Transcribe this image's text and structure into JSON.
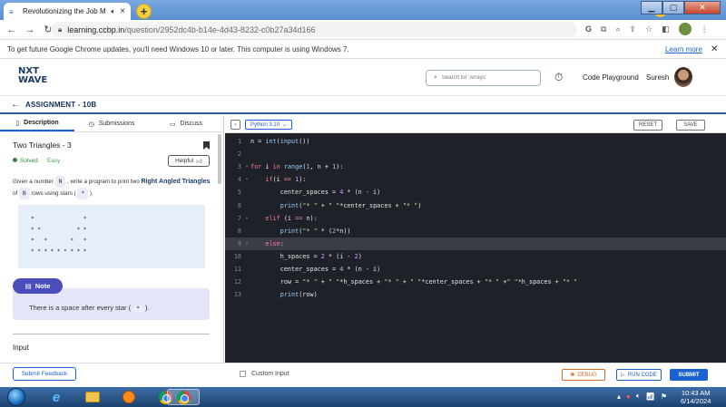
{
  "browser": {
    "tab_title": "Revolutionizing the Job Mar",
    "url_host": "learning.ccbp.in",
    "url_path": "/question/2952dc4b-b14e-4d43-8232-c0b27a34d166",
    "info_message": "To get future Google Chrome updates, you'll need Windows 10 or later. This computer is using Windows 7.",
    "learn_more": "Learn more"
  },
  "header": {
    "logo_line1": "NXT",
    "logo_line2": "WAVE",
    "search_placeholder": "Search for 'Arrays'",
    "code_playground": "Code Playground",
    "user_name": "Suresh"
  },
  "assignment": {
    "title": "ASSIGNMENT - 10B"
  },
  "left_tabs": [
    {
      "label": "Description",
      "icon": "document-icon"
    },
    {
      "label": "Submissions",
      "icon": "clock-icon"
    },
    {
      "label": "Discuss",
      "icon": "chat-icon"
    }
  ],
  "problem": {
    "title": "Two Triangles - 3",
    "status": "Solved",
    "difficulty": "Easy",
    "helpful": "Helpful",
    "desc_part1": "Given a number",
    "desc_chip1": "N",
    "desc_part2": ", write a program to print two",
    "desc_bold": "Right Angled Triangles",
    "desc_part3": "of",
    "desc_chip2": "N",
    "desc_part4": "rows using stars (",
    "desc_chip3": "*",
    "desc_part5": ").",
    "pattern": "*               *\n* *           * *\n*   *       *   *\n* * * * * * * * *",
    "note_label": "Note",
    "note_text_1": "There is a space after every star (",
    "note_chip": "*",
    "note_text_2": ").",
    "input_heading": "Input"
  },
  "editor": {
    "language": "Python 3.10",
    "reset": "RESET",
    "save": "SAVE"
  },
  "bottom": {
    "submit_feedback": "Submit Feedback",
    "custom_input": "Custom Input",
    "debug": "DEBUG",
    "run_code": "RUN CODE",
    "submit": "SUBMIT"
  },
  "taskbar": {
    "time": "10:43 AM",
    "date": "6/14/2024"
  }
}
